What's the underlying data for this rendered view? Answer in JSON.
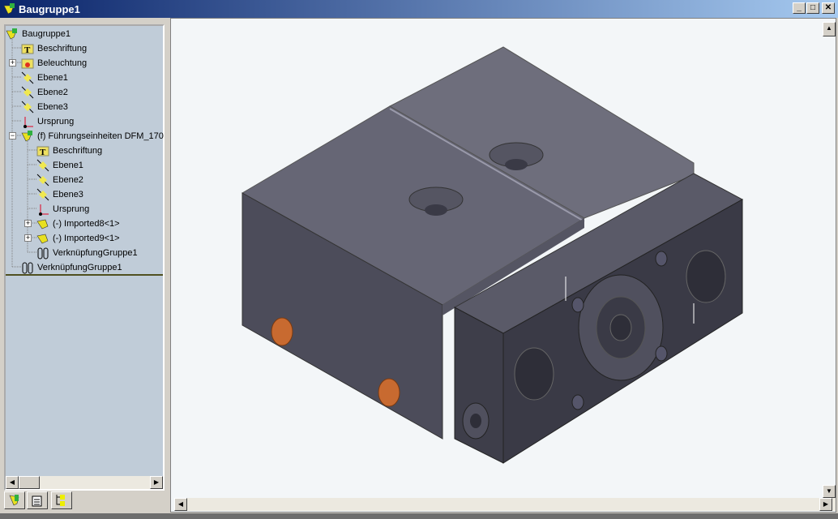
{
  "window": {
    "title": "Baugruppe1",
    "minimize": "_",
    "maximize": "□",
    "close": "✕"
  },
  "tree": [
    {
      "label": "Baugruppe1",
      "icon": "assembly-icon"
    },
    {
      "label": "Beschriftung",
      "icon": "annotation-icon"
    },
    {
      "label": "Beleuchtung",
      "icon": "lighting-icon"
    },
    {
      "label": "Ebene1",
      "icon": "plane-icon"
    },
    {
      "label": "Ebene2",
      "icon": "plane-icon"
    },
    {
      "label": "Ebene3",
      "icon": "plane-icon"
    },
    {
      "label": "Ursprung",
      "icon": "origin-icon"
    },
    {
      "label": "(f) Führungseinheiten DFM_170",
      "icon": "assembly-icon"
    },
    {
      "label": "Beschriftung",
      "icon": "annotation-icon"
    },
    {
      "label": "Ebene1",
      "icon": "plane-icon"
    },
    {
      "label": "Ebene2",
      "icon": "plane-icon"
    },
    {
      "label": "Ebene3",
      "icon": "plane-icon"
    },
    {
      "label": "Ursprung",
      "icon": "origin-icon"
    },
    {
      "label": "(-) Imported8<1>",
      "icon": "part-icon"
    },
    {
      "label": "(-) Imported9<1>",
      "icon": "part-icon"
    },
    {
      "label": "VerknüpfungGruppe1",
      "icon": "mates-icon"
    },
    {
      "label": "VerknüpfungGruppe1",
      "icon": "mates-icon"
    }
  ],
  "panel_tabs": [
    "feature-manager-tab",
    "property-manager-tab",
    "configuration-manager-tab"
  ],
  "colors": {
    "model": "#4a4a58",
    "model_top": "#6b6b7a",
    "hole": "#c86a30"
  }
}
